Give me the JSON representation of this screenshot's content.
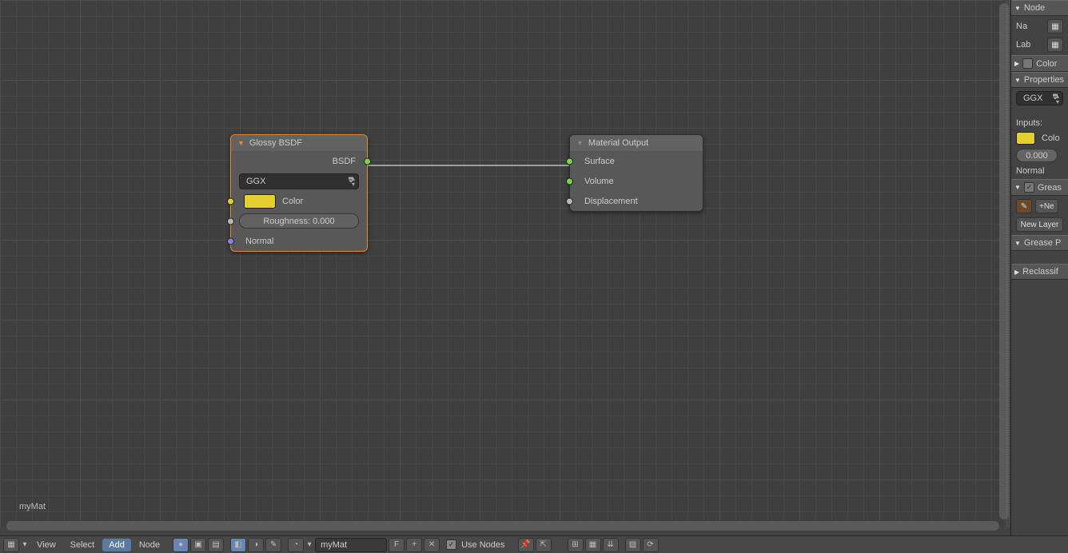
{
  "material_name": "myMat",
  "nodes": {
    "glossy": {
      "title": "Glossy BSDF",
      "out_bsdf": "BSDF",
      "distribution": "GGX",
      "color_label": "Color",
      "color_swatch": "#e3cf2f",
      "roughness_label": "Roughness:",
      "roughness_value": "0.000",
      "normal_label": "Normal"
    },
    "output": {
      "title": "Material Output",
      "surface": "Surface",
      "volume": "Volume",
      "displacement": "Displacement"
    }
  },
  "sidebar": {
    "node_panel": "Node",
    "na": "Na",
    "lab": "Lab",
    "color_panel": "Color",
    "properties_panel": "Properties",
    "distribution": "GGX",
    "inputs": "Inputs:",
    "color_label": "Colo",
    "roughness_value": "0.000",
    "normal_label": "Normal",
    "grease_panel": "Greas",
    "new_btn": "+Ne",
    "new_layer": "New Layer",
    "grease_pencil_panel": "Grease P",
    "reclassify_panel": "Reclassif"
  },
  "toolbar": {
    "view": "View",
    "select": "Select",
    "add": "Add",
    "node": "Node",
    "material": "myMat",
    "f": "F",
    "use_nodes": "Use Nodes"
  }
}
